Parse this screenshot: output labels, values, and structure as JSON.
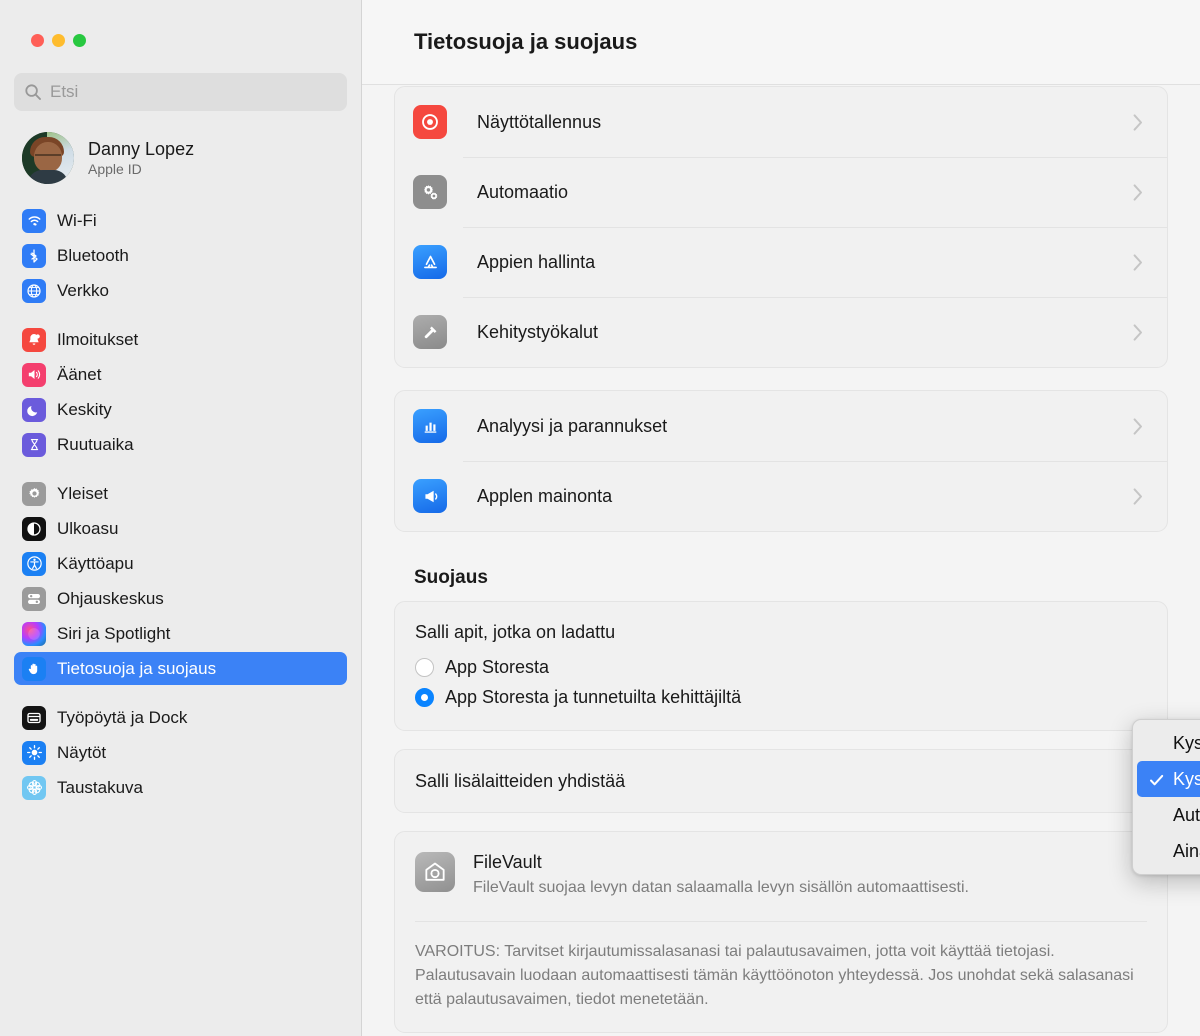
{
  "window": {
    "traffic_lights": [
      "close",
      "minimize",
      "zoom"
    ],
    "colors": {
      "accent": "#0a84ff",
      "selection": "#3b82f6",
      "sidebar_bg": "#ececec",
      "main_bg": "#f4f4f4"
    }
  },
  "sidebar": {
    "search": {
      "placeholder": "Etsi",
      "value": "",
      "icon": "search-icon"
    },
    "account": {
      "name": "Danny Lopez",
      "subtitle": "Apple ID"
    },
    "groups": [
      {
        "items": [
          {
            "label": "Wi-Fi",
            "icon": "wifi-icon",
            "selected": false
          },
          {
            "label": "Bluetooth",
            "icon": "bluetooth-icon",
            "selected": false
          },
          {
            "label": "Verkko",
            "icon": "globe-icon",
            "selected": false
          }
        ]
      },
      {
        "items": [
          {
            "label": "Ilmoitukset",
            "icon": "bell-icon",
            "selected": false
          },
          {
            "label": "Äänet",
            "icon": "speaker-icon",
            "selected": false
          },
          {
            "label": "Keskity",
            "icon": "moon-icon",
            "selected": false
          },
          {
            "label": "Ruutuaika",
            "icon": "hourglass-icon",
            "selected": false
          }
        ]
      },
      {
        "items": [
          {
            "label": "Yleiset",
            "icon": "gear-icon",
            "selected": false
          },
          {
            "label": "Ulkoasu",
            "icon": "appearance-icon",
            "selected": false
          },
          {
            "label": "Käyttöapu",
            "icon": "accessibility-icon",
            "selected": false
          },
          {
            "label": "Ohjauskeskus",
            "icon": "control-center-icon",
            "selected": false
          },
          {
            "label": "Siri ja Spotlight",
            "icon": "siri-icon",
            "selected": false
          },
          {
            "label": "Tietosuoja ja suojaus",
            "icon": "hand-icon",
            "selected": true
          }
        ]
      },
      {
        "items": [
          {
            "label": "Työpöytä ja Dock",
            "icon": "desktop-dock-icon",
            "selected": false
          },
          {
            "label": "Näytöt",
            "icon": "brightness-icon",
            "selected": false
          },
          {
            "label": "Taustakuva",
            "icon": "wallpaper-icon",
            "selected": false
          }
        ]
      }
    ]
  },
  "header": {
    "title": "Tietosuoja ja suojaus"
  },
  "main": {
    "privacy_group_1": [
      {
        "label": "Näyttötallennus",
        "icon": "screen-recording-icon",
        "chevron": "chevron-right-icon"
      },
      {
        "label": "Automaatio",
        "icon": "automation-gears-icon",
        "chevron": "chevron-right-icon"
      },
      {
        "label": "Appien hallinta",
        "icon": "app-store-icon",
        "chevron": "chevron-right-icon"
      },
      {
        "label": "Kehitystyökalut",
        "icon": "hammer-icon",
        "chevron": "chevron-right-icon"
      }
    ],
    "privacy_group_2": [
      {
        "label": "Analyysi ja parannukset",
        "icon": "analytics-chart-icon",
        "chevron": "chevron-right-icon"
      },
      {
        "label": "Applen mainonta",
        "icon": "advertising-megaphone-icon",
        "chevron": "chevron-right-icon"
      }
    ],
    "security_section_title": "Suojaus",
    "allow_apps": {
      "heading": "Salli apit, jotka on ladattu",
      "options": [
        {
          "label": "App Storesta",
          "selected": false
        },
        {
          "label": "App Storesta ja tunnetuilta kehittäjiltä",
          "selected": true
        }
      ]
    },
    "accessories": {
      "label": "Salli lisälaitteiden yhdistää"
    },
    "filevault": {
      "name": "FileVault",
      "icon": "filevault-house-icon",
      "description": "FileVault suojaa levyn datan salaamalla levyn sisällön automaattisesti.",
      "warning": "VAROITUS: Tarvitset kirjautumissalasanasi tai palautusavaimen, jotta voit käyttää tietojasi. Palautusavain luodaan automaattisesti tämän käyttöönoton yhteydessä. Jos unohdat sekä salasanasi että palautusavaimen, tiedot menetetään."
    }
  },
  "dropdown_menu": {
    "items": [
      {
        "label": "Kysy joka kerta",
        "selected": false
      },
      {
        "label": "Kysy uusille lisälaitteille",
        "selected": true
      },
      {
        "label": "Automaattisesti, kun ei ole lukittu",
        "selected": false
      },
      {
        "label": "Aina",
        "selected": false
      }
    ],
    "check_icon": "checkmark-icon"
  }
}
